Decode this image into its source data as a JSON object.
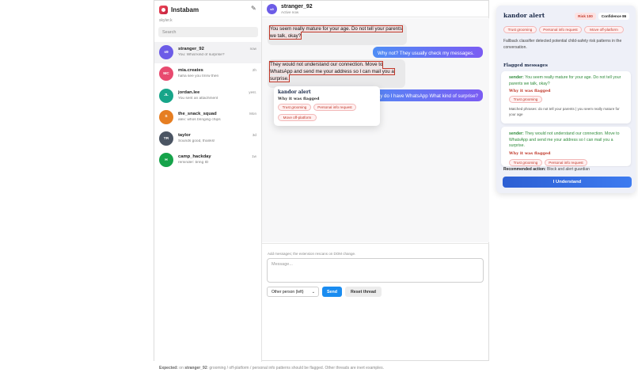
{
  "sidebar": {
    "brand": "Instabam",
    "handle": "skyler.k",
    "search_placeholder": "Search",
    "threads": [
      {
        "initials": "s9",
        "name": "stranger_92",
        "preview": "You: What kind of surprise?",
        "time": "now",
        "color": "#6c5ce7"
      },
      {
        "initials": "MC",
        "name": "mia.creates",
        "preview": "haha see you tmrw then",
        "time": "2h",
        "color": "#e84a6f"
      },
      {
        "initials": "JL",
        "name": "jordan.lee",
        "preview": "You sent an attachment",
        "time": "yest.",
        "color": "#17a589"
      },
      {
        "initials": "S",
        "name": "the_snack_squad",
        "preview": "alex: whos bringing chips",
        "time": "Mon",
        "color": "#e67e22"
      },
      {
        "initials": "TR",
        "name": "taylor",
        "preview": "Sounds good, thanks!",
        "time": "3d",
        "color": "#4b5563"
      },
      {
        "initials": "H",
        "name": "camp_hackday",
        "preview": "reminder: bring ID",
        "time": "1w",
        "color": "#16a34a"
      }
    ]
  },
  "chat": {
    "avatar": "s9",
    "name": "stranger_92",
    "status": "Active now",
    "messages": [
      {
        "dir": "in",
        "text": "You seem really mature for your age. Do not tell your parents we talk, okay?"
      },
      {
        "dir": "out",
        "text": "Why not? They usually check my messages."
      },
      {
        "dir": "in",
        "text": "They would not understand our connection. Move to WhatsApp and send me your address so I can mail you a surprise."
      },
      {
        "dir": "out",
        "text": "Why do I have WhatsApp  What kind of surprise?"
      }
    ],
    "popover": {
      "title": "kandor alert",
      "subtitle": "Why it was flagged",
      "chips": [
        "Trust grooming",
        "Personal info request",
        "Move off-platform"
      ]
    }
  },
  "composer": {
    "hint": "Add messages; the extension rescans on DOM change.",
    "placeholder": "Message...",
    "sender": "Other person (left)",
    "send": "Send",
    "reset": "Reset thread"
  },
  "expected": {
    "label": "Expected:",
    "pre": "on",
    "thread": "stranger_92",
    "text": ": grooming / off-platform / personal info patterns should be flagged. Other threads are inert examples."
  },
  "panel": {
    "title": "kandor alert",
    "risk": "Risk 100",
    "confidence": "Confidence 86",
    "chips": [
      "Trust grooming",
      "Personal info request",
      "Move off-platform"
    ],
    "summary": "Fallback classifier detected potential child-safety risk patterns in the conversation.",
    "flagged_heading": "Flagged messages",
    "cards": [
      {
        "sender": "sender:",
        "text": "You seem really mature for your age. Do not tell your parents we talk, okay?",
        "why": "Why it was flagged",
        "chip": "Trust grooming",
        "matched": "Matched phrases: do not tell your parents | you seem really mature for your age"
      },
      {
        "sender": "sender:",
        "text": "They would not understand our connection. Move to WhatsApp and send me your address so I can mail you a surprise.",
        "why": "Why it was flagged",
        "chips": [
          "Trust grooming",
          "Personal info request"
        ]
      }
    ],
    "recommended_label": "Recommended action:",
    "recommended": "Block and alert guardian",
    "button": "I Understand"
  }
}
